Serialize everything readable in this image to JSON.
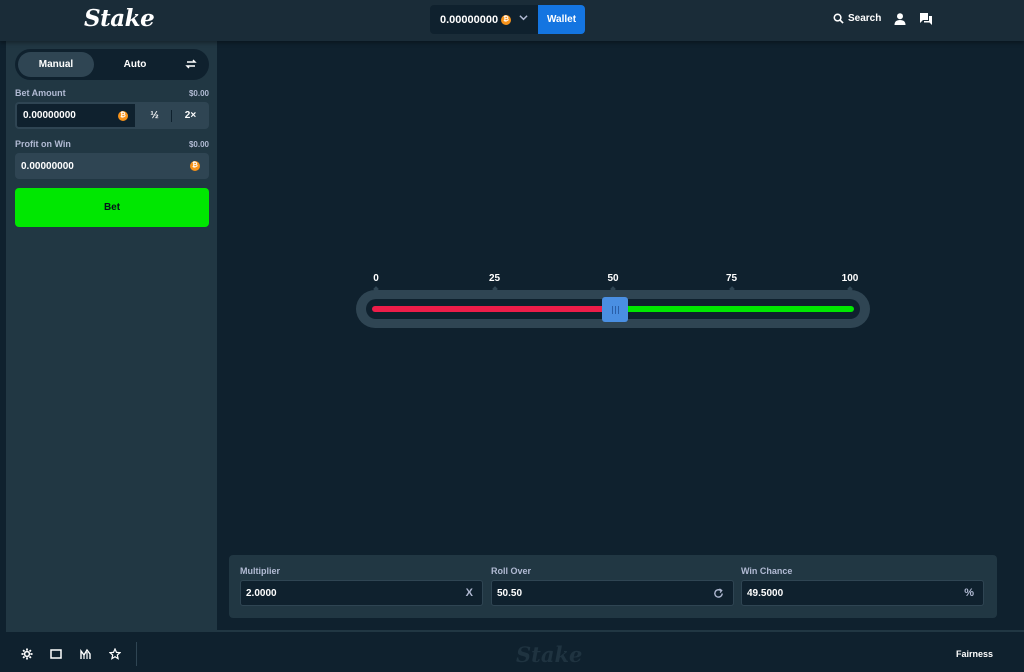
{
  "header": {
    "logo": "Stake",
    "balance": "0.00000000",
    "currency_symbol": "₿",
    "wallet_label": "Wallet",
    "search_label": "Search"
  },
  "sidebar": {
    "modes": [
      "Manual",
      "Auto"
    ],
    "active_mode": "Manual",
    "bet_amount_label": "Bet Amount",
    "bet_amount_usd": "$0.00",
    "bet_amount_value": "0.00000000",
    "half_label": "½",
    "double_label": "2×",
    "profit_label": "Profit on Win",
    "profit_usd": "$0.00",
    "profit_value": "0.00000000",
    "bet_button": "Bet"
  },
  "slider": {
    "ticks": [
      "0",
      "25",
      "50",
      "75",
      "100"
    ],
    "value": 50.5,
    "min": 0,
    "max": 100,
    "lose_color": "#ed1d49",
    "win_color": "#00e701"
  },
  "stats": {
    "multiplier_label": "Multiplier",
    "multiplier_value": "2.0000",
    "multiplier_suffix": "X",
    "roll_over_label": "Roll Over",
    "roll_over_value": "50.50",
    "win_chance_label": "Win Chance",
    "win_chance_value": "49.5000",
    "win_chance_suffix": "%"
  },
  "footer": {
    "icons": [
      "gear-icon",
      "screen-icon",
      "stats-icon",
      "star-icon"
    ],
    "logo": "Stake",
    "fairness_label": "Fairness"
  },
  "colors": {
    "accent": "#1475e1",
    "bet_green": "#00e701",
    "background": "#0f212e",
    "panel": "#213743"
  }
}
